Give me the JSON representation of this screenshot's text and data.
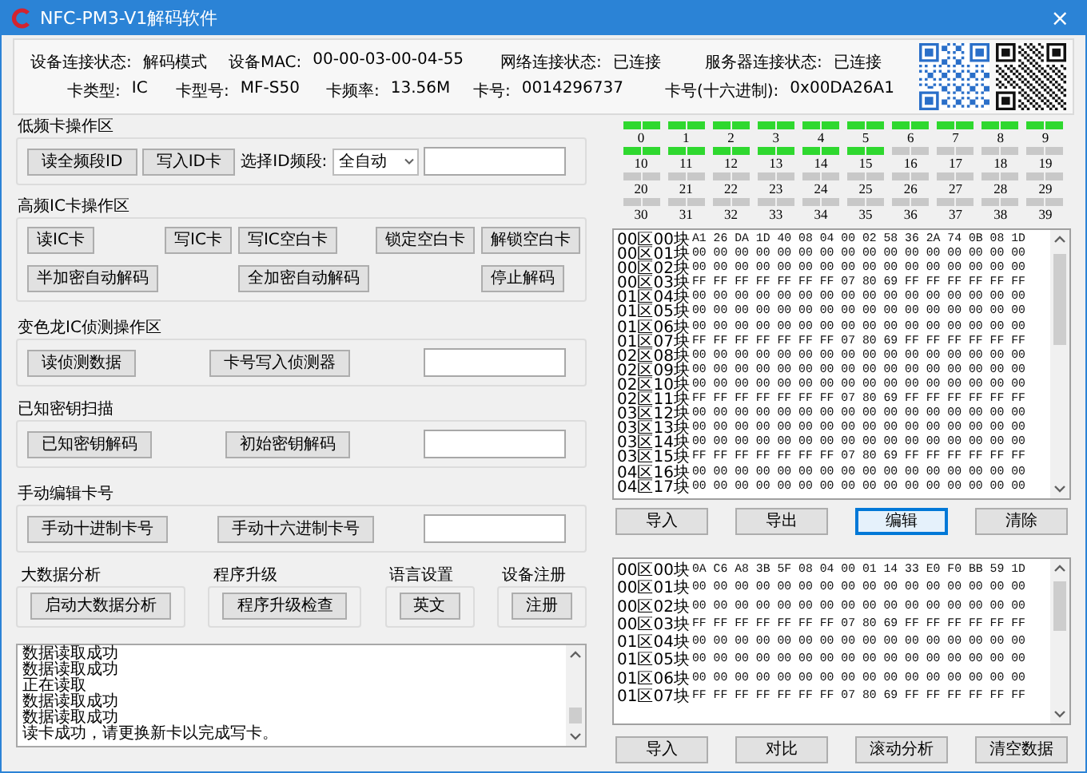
{
  "window": {
    "title": "NFC-PM3-V1解码软件",
    "close": "×"
  },
  "info": {
    "status": [
      {
        "label": "设备连接状态:",
        "value": "解码模式"
      },
      {
        "label": "设备MAC:",
        "value": "00-00-03-00-04-55"
      },
      {
        "label": "网络连接状态:",
        "value": "已连接"
      },
      {
        "label": "服务器连接状态:",
        "value": "已连接"
      }
    ],
    "card": [
      {
        "label": "卡类型:",
        "value": "IC"
      },
      {
        "label": "卡型号:",
        "value": "MF-S50"
      },
      {
        "label": "卡频率:",
        "value": "13.56M"
      },
      {
        "label": "卡号:",
        "value": "0014296737"
      },
      {
        "label": "卡号(十六进制):",
        "value": "0x00DA26A1"
      }
    ]
  },
  "groups": [
    {
      "title": "低频卡操作区",
      "rows": [
        [
          {
            "kind": "button",
            "label": "读全频段ID"
          },
          {
            "kind": "button",
            "label": "写入ID卡"
          },
          {
            "kind": "label",
            "text": "选择ID频段:"
          },
          {
            "kind": "select",
            "value": "全自动"
          },
          {
            "kind": "field"
          }
        ]
      ]
    },
    {
      "title": "高频IC卡操作区",
      "rows": [
        [
          {
            "kind": "button",
            "label": "读IC卡"
          },
          {
            "kind": "button",
            "label": "写IC卡"
          },
          {
            "kind": "button",
            "label": "写IC空白卡"
          },
          {
            "kind": "button",
            "label": "锁定空白卡"
          },
          {
            "kind": "button",
            "label": "解锁空白卡"
          }
        ],
        [
          {
            "kind": "button",
            "label": "半加密自动解码"
          },
          "",
          {
            "kind": "button",
            "label": "全加密自动解码"
          },
          "",
          {
            "kind": "button",
            "label": "停止解码"
          }
        ]
      ]
    },
    {
      "title": "变色龙IC侦测操作区",
      "rows": [
        [
          {
            "kind": "button",
            "label": "读侦测数据"
          },
          {
            "kind": "button",
            "label": "卡号写入侦测器"
          },
          {
            "kind": "field"
          }
        ]
      ]
    },
    {
      "title": "已知密钥扫描",
      "rows": [
        [
          {
            "kind": "button",
            "label": "已知密钥解码"
          },
          {
            "kind": "button",
            "label": "初始密钥解码"
          },
          {
            "kind": "field"
          }
        ]
      ]
    },
    {
      "title": "手动编辑卡号",
      "rows": [
        [
          {
            "kind": "button",
            "label": "手动十进制卡号"
          },
          {
            "kind": "button",
            "label": "手动十六进制卡号"
          },
          {
            "kind": "field"
          }
        ]
      ]
    }
  ],
  "tools": [
    {
      "title": "大数据分析",
      "button": "启动大数据分析"
    },
    {
      "title": "程序升级",
      "button": "程序升级检查"
    },
    {
      "title": "语言设置",
      "button": "英文"
    },
    {
      "title": "设备注册",
      "button": "注册"
    }
  ],
  "log": {
    "lines": [
      "数据读取成功",
      "数据读取成功",
      "正在读取",
      "数据读取成功",
      "数据读取成功",
      "读卡成功，请更换新卡以完成写卡。"
    ]
  },
  "sectors": [
    {
      "label": "0",
      "active": true
    },
    {
      "label": "1",
      "active": true
    },
    {
      "label": "2",
      "active": true
    },
    {
      "label": "3",
      "active": true
    },
    {
      "label": "4",
      "active": true
    },
    {
      "label": "5",
      "active": true
    },
    {
      "label": "6",
      "active": true
    },
    {
      "label": "7",
      "active": true
    },
    {
      "label": "8",
      "active": true
    },
    {
      "label": "9",
      "active": true
    },
    {
      "label": "10",
      "active": true
    },
    {
      "label": "11",
      "active": true
    },
    {
      "label": "12",
      "active": true
    },
    {
      "label": "13",
      "active": true
    },
    {
      "label": "14",
      "active": true
    },
    {
      "label": "15",
      "active": true
    },
    {
      "label": "16",
      "active": false
    },
    {
      "label": "17",
      "active": false
    },
    {
      "label": "18",
      "active": false
    },
    {
      "label": "19",
      "active": false
    },
    {
      "label": "20",
      "active": false
    },
    {
      "label": "21",
      "active": false
    },
    {
      "label": "22",
      "active": false
    },
    {
      "label": "23",
      "active": false
    },
    {
      "label": "24",
      "active": false
    },
    {
      "label": "25",
      "active": false
    },
    {
      "label": "26",
      "active": false
    },
    {
      "label": "27",
      "active": false
    },
    {
      "label": "28",
      "active": false
    },
    {
      "label": "29",
      "active": false
    },
    {
      "label": "30",
      "active": false
    },
    {
      "label": "31",
      "active": false
    },
    {
      "label": "32",
      "active": false
    },
    {
      "label": "33",
      "active": false
    },
    {
      "label": "34",
      "active": false
    },
    {
      "label": "35",
      "active": false
    },
    {
      "label": "36",
      "active": false
    },
    {
      "label": "37",
      "active": false
    },
    {
      "label": "38",
      "active": false
    },
    {
      "label": "39",
      "active": false
    }
  ],
  "hex_panels": [
    {
      "rows": [
        {
          "label": "00区00块",
          "bytes": "A1 26 DA 1D 40 08 04 00 02 58 36 2A 74 0B 08 1D"
        },
        {
          "label": "00区01块",
          "bytes": "00 00 00 00 00 00 00 00 00 00 00 00 00 00 00 00"
        },
        {
          "label": "00区02块",
          "bytes": "00 00 00 00 00 00 00 00 00 00 00 00 00 00 00 00"
        },
        {
          "label": "00区03块",
          "bytes": "FF FF FF FF FF FF FF 07 80 69 FF FF FF FF FF FF"
        },
        {
          "label": "01区04块",
          "bytes": "00 00 00 00 00 00 00 00 00 00 00 00 00 00 00 00"
        },
        {
          "label": "01区05块",
          "bytes": "00 00 00 00 00 00 00 00 00 00 00 00 00 00 00 00"
        },
        {
          "label": "01区06块",
          "bytes": "00 00 00 00 00 00 00 00 00 00 00 00 00 00 00 00"
        },
        {
          "label": "01区07块",
          "bytes": "FF FF FF FF FF FF FF 07 80 69 FF FF FF FF FF FF"
        },
        {
          "label": "02区08块",
          "bytes": "00 00 00 00 00 00 00 00 00 00 00 00 00 00 00 00"
        },
        {
          "label": "02区09块",
          "bytes": "00 00 00 00 00 00 00 00 00 00 00 00 00 00 00 00"
        },
        {
          "label": "02区10块",
          "bytes": "00 00 00 00 00 00 00 00 00 00 00 00 00 00 00 00"
        },
        {
          "label": "02区11块",
          "bytes": "FF FF FF FF FF FF FF 07 80 69 FF FF FF FF FF FF"
        },
        {
          "label": "03区12块",
          "bytes": "00 00 00 00 00 00 00 00 00 00 00 00 00 00 00 00"
        },
        {
          "label": "03区13块",
          "bytes": "00 00 00 00 00 00 00 00 00 00 00 00 00 00 00 00"
        },
        {
          "label": "03区14块",
          "bytes": "00 00 00 00 00 00 00 00 00 00 00 00 00 00 00 00"
        },
        {
          "label": "03区15块",
          "bytes": "FF FF FF FF FF FF FF 07 80 69 FF FF FF FF FF FF"
        },
        {
          "label": "04区16块",
          "bytes": "00 00 00 00 00 00 00 00 00 00 00 00 00 00 00 00"
        },
        {
          "label": "04区17块",
          "bytes": "00 00 00 00 00 00 00 00 00 00 00 00 00 00 00 00"
        }
      ],
      "buttons": [
        {
          "label": "导入",
          "focused": false
        },
        {
          "label": "导出",
          "focused": false
        },
        {
          "label": "编辑",
          "focused": true
        },
        {
          "label": "清除",
          "focused": false
        }
      ]
    },
    {
      "rows": [
        {
          "label": "00区00块",
          "bytes": "0A C6 A8 3B 5F 08 04 00 01 14 33 E0 F0 BB 59 1D"
        },
        {
          "label": "00区01块",
          "bytes": "00 00 00 00 00 00 00 00 00 00 00 00 00 00 00 00"
        },
        {
          "label": "00区02块",
          "bytes": "00 00 00 00 00 00 00 00 00 00 00 00 00 00 00 00"
        },
        {
          "label": "00区03块",
          "bytes": "FF FF FF FF FF FF FF 07 80 69 FF FF FF FF FF FF"
        },
        {
          "label": "01区04块",
          "bytes": "00 00 00 00 00 00 00 00 00 00 00 00 00 00 00 00"
        },
        {
          "label": "01区05块",
          "bytes": "00 00 00 00 00 00 00 00 00 00 00 00 00 00 00 00"
        },
        {
          "label": "01区06块",
          "bytes": "00 00 00 00 00 00 00 00 00 00 00 00 00 00 00 00"
        },
        {
          "label": "01区07块",
          "bytes": "FF FF FF FF FF FF FF 07 80 69 FF FF FF FF FF FF"
        }
      ],
      "buttons": [
        {
          "label": "导入",
          "focused": false
        },
        {
          "label": "对比",
          "focused": false
        },
        {
          "label": "滚动分析",
          "focused": false
        },
        {
          "label": "清空数据",
          "focused": false
        }
      ]
    }
  ]
}
